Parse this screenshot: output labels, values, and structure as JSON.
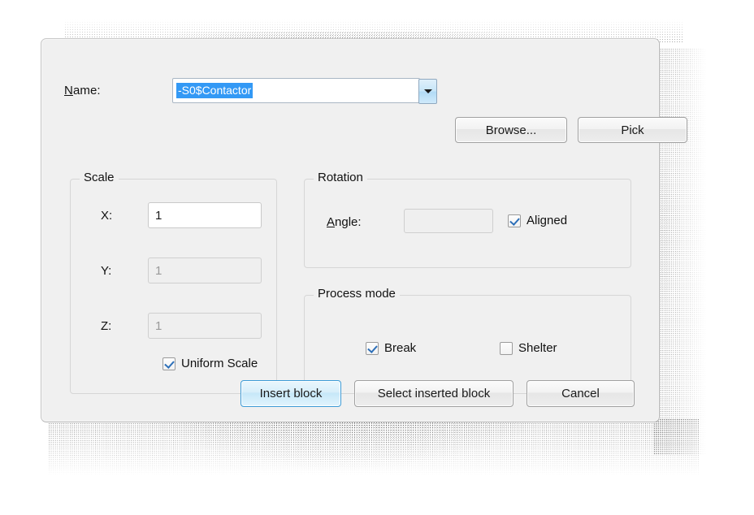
{
  "dialog": {
    "name_row": {
      "label": "Name:",
      "label_accel": "N",
      "label_rest": "ame:",
      "value": "-S0$Contactor",
      "value_selected": true,
      "dropdown_icon": "chevron-down-icon",
      "browse_label": "Browse...",
      "pick_label": "Pick"
    },
    "scale_group": {
      "title": "Scale",
      "x_label": "X:",
      "x_value": "1",
      "x_enabled": true,
      "y_label": "Y:",
      "y_value": "1",
      "y_enabled": false,
      "z_label": "Z:",
      "z_value": "1",
      "z_enabled": false,
      "uniform_scale_label": "Uniform Scale",
      "uniform_scale_checked": true
    },
    "rotation_group": {
      "title": "Rotation",
      "angle_label": "Angle:",
      "angle_accel": "A",
      "angle_rest": "ngle:",
      "angle_value": "",
      "angle_enabled": false,
      "aligned_label": "Aligned",
      "aligned_checked": true
    },
    "process_mode_group": {
      "title": "Process mode",
      "break_label": "Break",
      "break_checked": true,
      "shelter_label": "Shelter",
      "shelter_checked": false
    },
    "footer": {
      "insert_block_label": "Insert block",
      "select_inserted_block_label": "Select inserted block",
      "cancel_label": "Cancel"
    }
  },
  "colors": {
    "dialog_face": "#f0f0f0",
    "selection_blue": "#3399f5",
    "default_button_border": "#3c9bd6",
    "check_blue": "#2d6fb8",
    "group_border": "#d6d6d6"
  }
}
